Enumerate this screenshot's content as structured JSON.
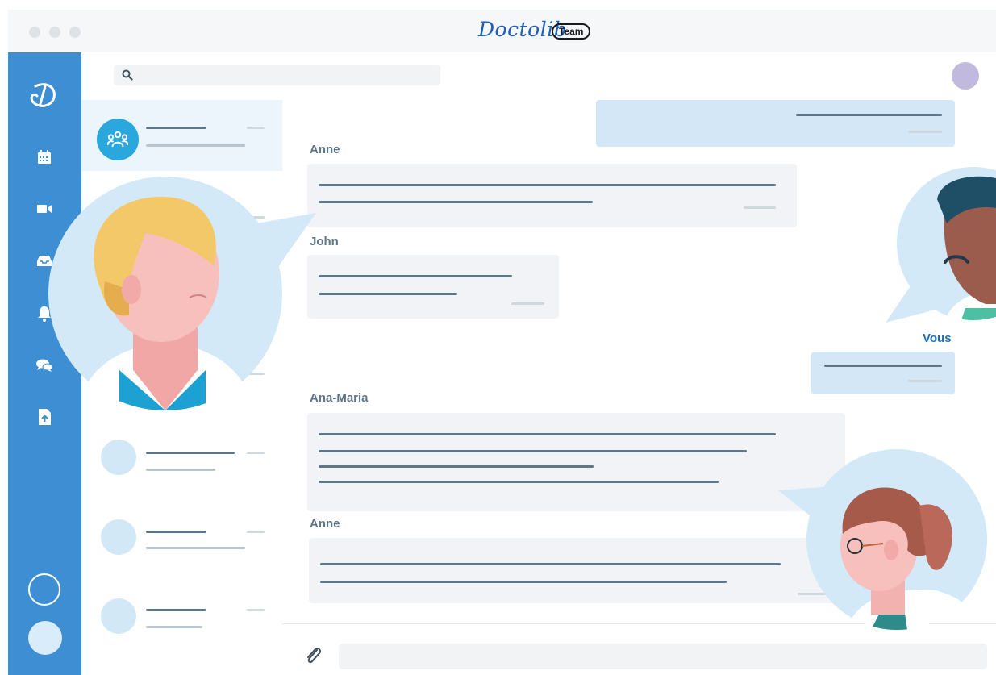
{
  "app": {
    "logo_text": "Doctolib",
    "badge": "Team"
  },
  "rail": {
    "icons": [
      "doctolib-brand-icon",
      "calendar-icon",
      "video-camera-icon",
      "inbox-tray-icon",
      "bell-icon",
      "chat-bubbles-icon",
      "file-upload-icon"
    ]
  },
  "search": {
    "placeholder": ""
  },
  "messages": {
    "senders": {
      "anne_1": "Anne",
      "john": "John",
      "me": "Vous",
      "ana_maria": "Ana-Maria",
      "anne_2": "Anne"
    }
  },
  "colors": {
    "rail": "#3d8ed2",
    "accent": "#2aa8dd",
    "my_bubble": "#d4e7f6",
    "other_bubble": "#f1f3f6",
    "sender_me": "#1e6fb7"
  }
}
